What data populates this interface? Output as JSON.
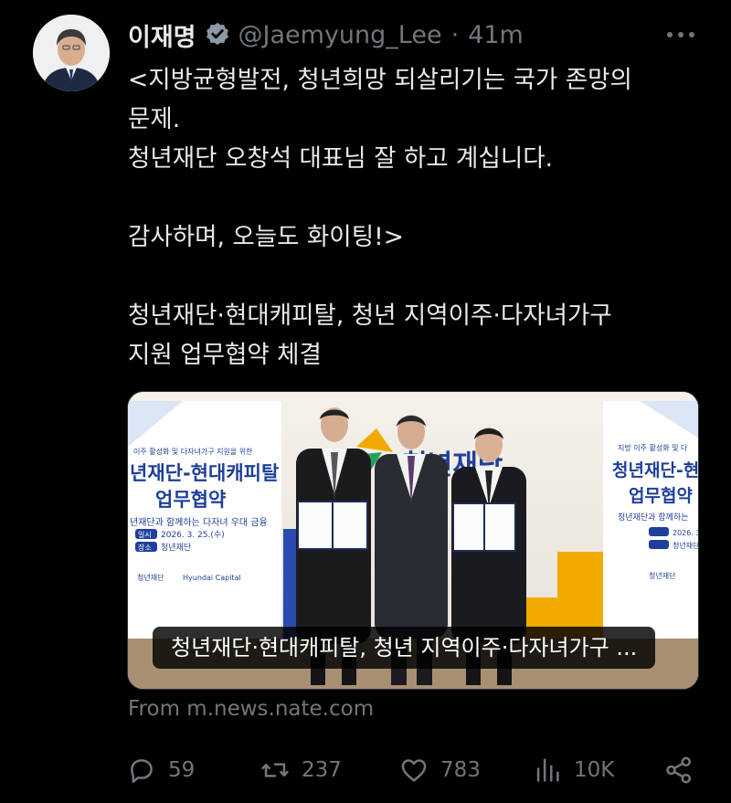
{
  "author": {
    "name": "이재명",
    "handle": "@Jaemyung_Lee",
    "separator": "·",
    "time": "41m"
  },
  "tweet": {
    "text": "<지방균형발전, 청년희망 되살리기는 국가 존망의\n문제.\n청년재단 오창석 대표님 잘 하고 계십니다.\n\n감사하며, 오늘도 화이팅!>\n\n청년재단·현대캐피탈, 청년 지역이주·다자녀가구\n지원 업무협약 체결"
  },
  "card": {
    "caption": "청년재단·현대캐피탈, 청년 지역이주·다자녀가구 ...",
    "source": "From m.news.nate.com",
    "banner": {
      "kicker": "이주 활성화 및 다자녀가구 지원을 위한",
      "title1": "년재단-현대캐피탈",
      "title2": "업무협약",
      "subtitle": "년재단과 함께하는 다자녀 우대 금융",
      "date_label": "일시",
      "date": "2026. 3. 25.(수)",
      "place_label": "장소",
      "place": "청년재단",
      "logo1": "청년재단",
      "logo2": "Hyundai Capital",
      "wall_logo": "청년재단",
      "right_kicker": "지방 이주 활성화 및 다",
      "right_title1": "청년재단-현",
      "right_title2": "업무협약",
      "right_subtitle": "청년재단과 함께하는",
      "right_date": "2026. 3.",
      "right_place": "청년재단",
      "right_logo": "청년재단"
    }
  },
  "actions": {
    "replies": "59",
    "retweets": "237",
    "likes": "783",
    "views": "10K"
  },
  "colors": {
    "verified": "#8b98a5",
    "muted": "#71767b",
    "text": "#e7e9ea",
    "banner_blue": "#1f3f9a",
    "banner_accent": "#f2a900"
  }
}
